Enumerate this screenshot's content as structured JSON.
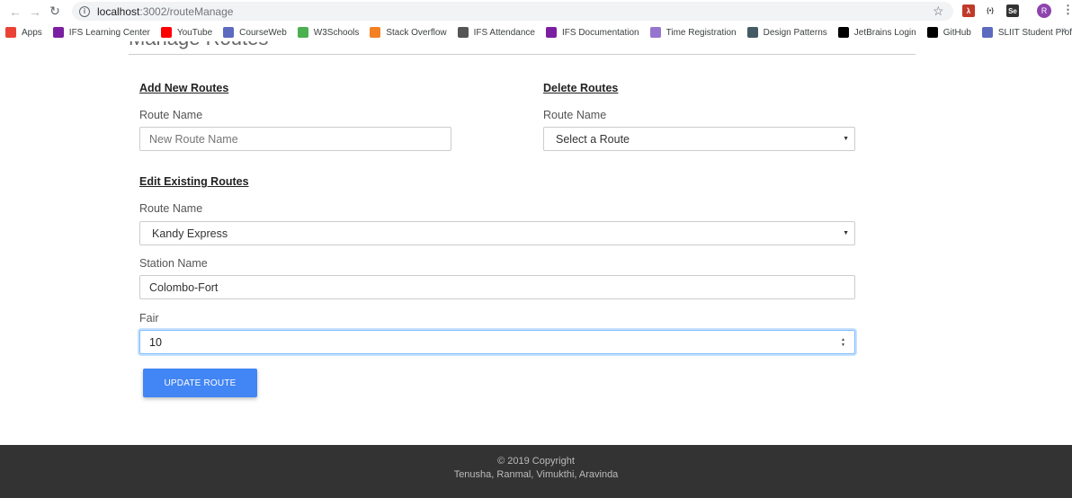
{
  "browser": {
    "url_host": "localhost",
    "url_path": ":3002/routeManage",
    "bookmarks": [
      {
        "label": "Apps",
        "icon": "apps-grid-icon",
        "color": "#ea4335"
      },
      {
        "label": "IFS Learning Center",
        "icon": "ifs-logo-icon",
        "color": "#7b1fa2"
      },
      {
        "label": "YouTube",
        "icon": "youtube-icon",
        "color": "#ff0000"
      },
      {
        "label": "CourseWeb",
        "icon": "courseweb-icon",
        "color": "#5c6bc0"
      },
      {
        "label": "W3Schools",
        "icon": "w3schools-icon",
        "color": "#4caf50"
      },
      {
        "label": "Stack Overflow",
        "icon": "stackoverflow-icon",
        "color": "#f48024"
      },
      {
        "label": "IFS Attendance",
        "icon": "globe-icon",
        "color": "#555555"
      },
      {
        "label": "IFS Documentation",
        "icon": "ifs-logo-icon",
        "color": "#7b1fa2"
      },
      {
        "label": "Time Registration",
        "icon": "clock-icon",
        "color": "#9575cd"
      },
      {
        "label": "Design Patterns",
        "icon": "diamond-icon",
        "color": "#455a64"
      },
      {
        "label": "JetBrains Login",
        "icon": "jetbrains-icon",
        "color": "#000000"
      },
      {
        "label": "GitHub",
        "icon": "github-icon",
        "color": "#000000"
      },
      {
        "label": "SLIIT Student Profile",
        "icon": "sliit-icon",
        "color": "#5c6bc0"
      }
    ]
  },
  "page": {
    "heading": "Manage Routes",
    "add": {
      "title": "Add New Routes",
      "label": "Route Name",
      "placeholder": "New Route Name"
    },
    "delete": {
      "title": "Delete Routes",
      "label": "Route Name",
      "selected": "Select a Route"
    },
    "edit": {
      "title": "Edit Existing Routes",
      "route_label": "Route Name",
      "route_selected": "Kandy Express",
      "station_label": "Station Name",
      "station_value": "Colombo-Fort",
      "fair_label": "Fair",
      "fair_value": "10",
      "button": "UPDATE ROUTE"
    }
  },
  "footer": {
    "copyright": "© 2019 Copyright",
    "authors": "Tenusha, Ranmal, Vimukthi, Aravinda"
  },
  "colors": {
    "button": "#4285f4",
    "footer_bg": "#333333"
  }
}
